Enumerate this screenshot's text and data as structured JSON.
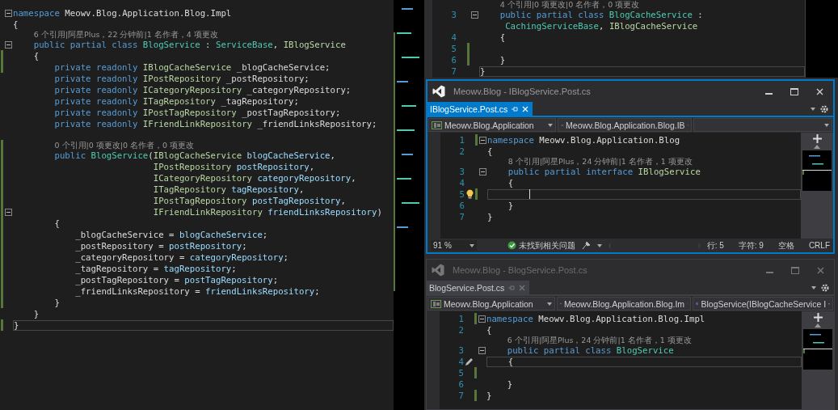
{
  "left_editor": {
    "lines": [
      {
        "changed": false,
        "fold": true,
        "tokens": [
          {
            "kind": "kw",
            "text": "namespace"
          },
          {
            "kind": "plain",
            "text": " Meowv.Blog.Application.Blog.Impl"
          }
        ]
      },
      {
        "changed": false,
        "tokens": [
          {
            "kind": "plain",
            "text": "{"
          }
        ]
      },
      {
        "changed": false,
        "tokens": [
          {
            "kind": "lens",
            "text": "    6 个引用|阿星Plus，22 分钟前|1 名作者，4 项更改"
          }
        ]
      },
      {
        "changed": false,
        "fold": true,
        "tokens": [
          {
            "kind": "kw",
            "text": "    public partial class"
          },
          {
            "kind": "type",
            "text": " BlogService"
          },
          {
            "kind": "plain",
            "text": " : "
          },
          {
            "kind": "type",
            "text": "ServiceBase"
          },
          {
            "kind": "plain",
            "text": ", "
          },
          {
            "kind": "iface",
            "text": "IBlogService"
          }
        ]
      },
      {
        "changed": true,
        "tokens": [
          {
            "kind": "plain",
            "text": "    {"
          }
        ]
      },
      {
        "changed": true,
        "tokens": [
          {
            "kind": "kw",
            "text": "        private readonly"
          },
          {
            "kind": "iface",
            "text": " IBlogCacheService"
          },
          {
            "kind": "plain",
            "text": " _blogCacheService;"
          }
        ]
      },
      {
        "changed": false,
        "tokens": [
          {
            "kind": "kw",
            "text": "        private readonly"
          },
          {
            "kind": "iface",
            "text": " IPostRepository"
          },
          {
            "kind": "plain",
            "text": " _postRepository;"
          }
        ]
      },
      {
        "changed": false,
        "tokens": [
          {
            "kind": "kw",
            "text": "        private readonly"
          },
          {
            "kind": "iface",
            "text": " ICategoryRepository"
          },
          {
            "kind": "plain",
            "text": " _categoryRepository;"
          }
        ]
      },
      {
        "changed": false,
        "tokens": [
          {
            "kind": "kw",
            "text": "        private readonly"
          },
          {
            "kind": "iface",
            "text": " ITagRepository"
          },
          {
            "kind": "plain",
            "text": " _tagRepository;"
          }
        ]
      },
      {
        "changed": false,
        "tokens": [
          {
            "kind": "kw",
            "text": "        private readonly"
          },
          {
            "kind": "iface",
            "text": " IPostTagRepository"
          },
          {
            "kind": "plain",
            "text": " _postTagRepository;"
          }
        ]
      },
      {
        "changed": false,
        "tokens": [
          {
            "kind": "kw",
            "text": "        private readonly"
          },
          {
            "kind": "iface",
            "text": " IFriendLinkRepository"
          },
          {
            "kind": "plain",
            "text": " _friendLinksRepository;"
          }
        ]
      },
      {
        "changed": false
      },
      {
        "changed": true,
        "tokens": [
          {
            "kind": "lens",
            "text": "        0 个引用|0 项更改|0 名作者，0 项更改"
          }
        ]
      },
      {
        "changed": true,
        "tokens": [
          {
            "kind": "kw",
            "text": "        public"
          },
          {
            "kind": "type",
            "text": " BlogService"
          },
          {
            "kind": "plain",
            "text": "("
          },
          {
            "kind": "iface",
            "text": "IBlogCacheService"
          },
          {
            "kind": "param",
            "text": " blogCacheService"
          },
          {
            "kind": "plain",
            "text": ","
          }
        ]
      },
      {
        "changed": true,
        "tokens": [
          {
            "kind": "iface",
            "text": "                           IPostRepository"
          },
          {
            "kind": "param",
            "text": " postRepository"
          },
          {
            "kind": "plain",
            "text": ","
          }
        ]
      },
      {
        "changed": true,
        "tokens": [
          {
            "kind": "iface",
            "text": "                           ICategoryRepository"
          },
          {
            "kind": "param",
            "text": " categoryRepository"
          },
          {
            "kind": "plain",
            "text": ","
          }
        ]
      },
      {
        "changed": true,
        "tokens": [
          {
            "kind": "iface",
            "text": "                           ITagRepository"
          },
          {
            "kind": "param",
            "text": " tagRepository"
          },
          {
            "kind": "plain",
            "text": ","
          }
        ]
      },
      {
        "changed": true,
        "tokens": [
          {
            "kind": "iface",
            "text": "                           IPostTagRepository"
          },
          {
            "kind": "param",
            "text": " postTagRepository"
          },
          {
            "kind": "plain",
            "text": ","
          }
        ]
      },
      {
        "changed": true,
        "fold": true,
        "tokens": [
          {
            "kind": "iface",
            "text": "                           IFriendLinkRepository"
          },
          {
            "kind": "param",
            "text": " friendLinksRepository"
          },
          {
            "kind": "plain",
            "text": ")"
          }
        ]
      },
      {
        "changed": true,
        "tokens": [
          {
            "kind": "plain",
            "text": "        {"
          }
        ]
      },
      {
        "changed": true,
        "tokens": [
          {
            "kind": "plain",
            "text": "            _blogCacheService = "
          },
          {
            "kind": "param",
            "text": "blogCacheService"
          },
          {
            "kind": "plain",
            "text": ";"
          }
        ]
      },
      {
        "changed": true,
        "tokens": [
          {
            "kind": "plain",
            "text": "            _postRepository = "
          },
          {
            "kind": "param",
            "text": "postRepository"
          },
          {
            "kind": "plain",
            "text": ";"
          }
        ]
      },
      {
        "changed": true,
        "tokens": [
          {
            "kind": "plain",
            "text": "            _categoryRepository = "
          },
          {
            "kind": "param",
            "text": "categoryRepository"
          },
          {
            "kind": "plain",
            "text": ";"
          }
        ]
      },
      {
        "changed": true,
        "tokens": [
          {
            "kind": "plain",
            "text": "            _tagRepository = "
          },
          {
            "kind": "param",
            "text": "tagRepository"
          },
          {
            "kind": "plain",
            "text": ";"
          }
        ]
      },
      {
        "changed": true,
        "tokens": [
          {
            "kind": "plain",
            "text": "            _postTagRepository = "
          },
          {
            "kind": "param",
            "text": "postTagRepository"
          },
          {
            "kind": "plain",
            "text": ";"
          }
        ]
      },
      {
        "changed": true,
        "tokens": [
          {
            "kind": "plain",
            "text": "            _friendLinksRepository = "
          },
          {
            "kind": "param",
            "text": "friendLinksRepository"
          },
          {
            "kind": "plain",
            "text": ";"
          }
        ]
      },
      {
        "changed": true,
        "tokens": [
          {
            "kind": "plain",
            "text": "        }"
          }
        ]
      },
      {
        "changed": false,
        "tokens": [
          {
            "kind": "plain",
            "text": "    }"
          }
        ]
      },
      {
        "changed": true,
        "current": true,
        "tokens": [
          {
            "kind": "plain",
            "text": "}"
          }
        ]
      }
    ]
  },
  "top_right_editor": {
    "lines": [
      {
        "changed": false,
        "tokens": [
          {
            "kind": "lens",
            "text": "    4 个引用|0 项更改|0 名作者，0 项更改"
          }
        ]
      },
      {
        "number": "3",
        "changed": false,
        "fold": true,
        "tokens": [
          {
            "kind": "kw",
            "text": "    public partial class"
          },
          {
            "kind": "type",
            "text": " BlogCacheService"
          },
          {
            "kind": "plain",
            "text": " :"
          }
        ]
      },
      {
        "changed": false,
        "tokens": [
          {
            "kind": "type",
            "text": "     CachingServiceBase"
          },
          {
            "kind": "plain",
            "text": ", "
          },
          {
            "kind": "iface",
            "text": "IBlogCacheService"
          }
        ]
      },
      {
        "number": "4",
        "changed": false,
        "tokens": [
          {
            "kind": "plain",
            "text": "    {"
          }
        ]
      },
      {
        "number": "5",
        "changed": true
      },
      {
        "number": "6",
        "changed": true,
        "tokens": [
          {
            "kind": "plain",
            "text": "    }"
          }
        ]
      },
      {
        "number": "7",
        "changed": false,
        "current": true,
        "tokens": [
          {
            "kind": "plain",
            "text": "}"
          }
        ]
      }
    ]
  },
  "windows": [
    {
      "title": "Meowv.Blog - IBlogService.Post.cs",
      "active": true,
      "tab": {
        "label": "IBlogService.Post.cs",
        "selected": true
      },
      "nav": [
        {
          "kind": "project",
          "text": "Meowv.Blog.Application"
        },
        {
          "kind": "namespace",
          "text": "Meowv.Blog.Application.Blog.IB"
        },
        {
          "kind": "empty"
        }
      ],
      "lines": [
        {
          "number": "1",
          "changed": true,
          "fold": true,
          "tokens": [
            {
              "kind": "kw",
              "text": "namespace"
            },
            {
              "kind": "plain",
              "text": " Meowv.Blog.Application.Blog"
            }
          ]
        },
        {
          "number": "2",
          "changed": false,
          "tokens": [
            {
              "kind": "plain",
              "text": "{"
            }
          ]
        },
        {
          "changed": false,
          "tokens": [
            {
              "kind": "lens",
              "text": "    8 个引用|阿星Plus，24 分钟前|1 名作者，1 项更改"
            }
          ]
        },
        {
          "number": "3",
          "changed": false,
          "fold": true,
          "tokens": [
            {
              "kind": "kw",
              "text": "    public partial interface"
            },
            {
              "kind": "iface",
              "text": " IBlogService"
            }
          ]
        },
        {
          "number": "4",
          "changed": false,
          "tokens": [
            {
              "kind": "plain",
              "text": "    {"
            }
          ]
        },
        {
          "number": "5",
          "changed": true,
          "current": true,
          "caret": true,
          "lightbulb": true
        },
        {
          "number": "6",
          "changed": false,
          "tokens": [
            {
              "kind": "plain",
              "text": "    }"
            }
          ]
        },
        {
          "number": "7",
          "changed": false,
          "tokens": [
            {
              "kind": "plain",
              "text": "}"
            }
          ]
        }
      ],
      "status_bar": {
        "zoom": "91 %",
        "issues": "未找到相关问题",
        "line": "行: 5",
        "char": "字符: 9",
        "indent": "空格",
        "eol": "CRLF"
      }
    },
    {
      "title": "Meowv.Blog - BlogService.Post.cs",
      "active": false,
      "tab": {
        "label": "BlogService.Post.cs",
        "selected": false
      },
      "nav": [
        {
          "kind": "project",
          "text": "Meowv.Blog.Application"
        },
        {
          "kind": "class",
          "text": "Meowv.Blog.Application.Blog.Im"
        },
        {
          "kind": "method",
          "text": "BlogService(IBlogCacheService I"
        }
      ],
      "lines": [
        {
          "number": "1",
          "changed": true,
          "fold": true,
          "tokens": [
            {
              "kind": "kw",
              "text": "namespace"
            },
            {
              "kind": "plain",
              "text": " Meowv.Blog.Application.Blog.Impl"
            }
          ]
        },
        {
          "number": "2",
          "changed": false,
          "tokens": [
            {
              "kind": "plain",
              "text": "{"
            }
          ]
        },
        {
          "changed": false,
          "tokens": [
            {
              "kind": "lens",
              "text": "    6 个引用|阿星Plus，24 分钟前|1 名作者，1 项更改"
            }
          ]
        },
        {
          "number": "3",
          "changed": false,
          "fold": true,
          "tokens": [
            {
              "kind": "kw",
              "text": "    public partial class"
            },
            {
              "kind": "type",
              "text": " BlogService"
            }
          ]
        },
        {
          "number": "4",
          "changed": false,
          "current": true,
          "pencil": true,
          "tokens": [
            {
              "kind": "plain",
              "text": "    {"
            }
          ]
        },
        {
          "number": "5",
          "changed": true
        },
        {
          "number": "6",
          "changed": false,
          "tokens": [
            {
              "kind": "plain",
              "text": "    }"
            }
          ]
        },
        {
          "number": "7",
          "changed": true,
          "tokens": [
            {
              "kind": "plain",
              "text": "}"
            }
          ]
        }
      ]
    }
  ]
}
